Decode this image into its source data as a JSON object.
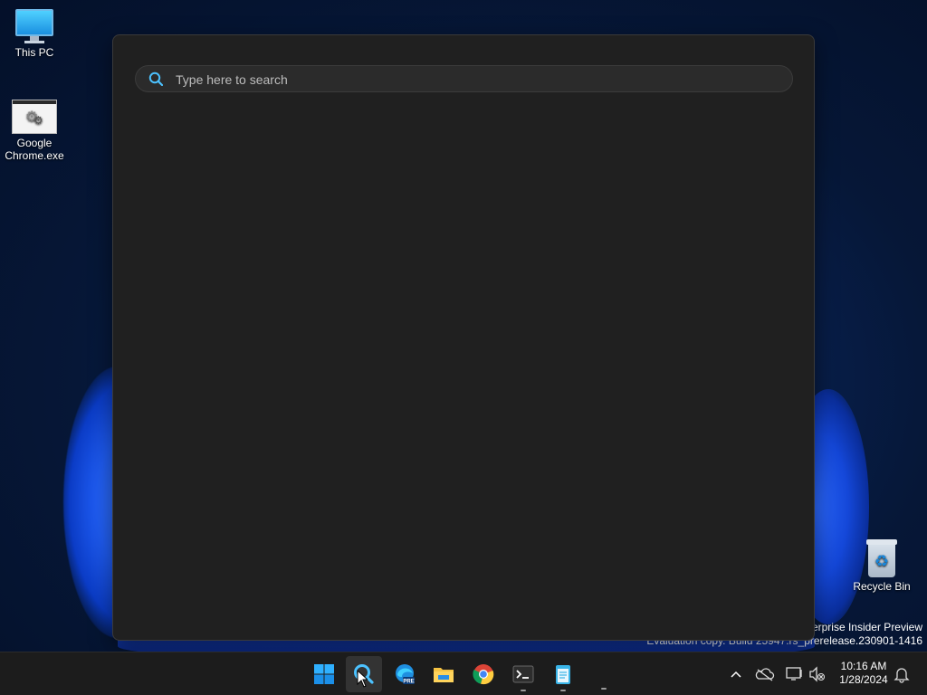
{
  "desktop": {
    "icons": [
      {
        "label": "This PC"
      },
      {
        "label": "Google\nChrome.exe"
      },
      {
        "label": "Recycle Bin"
      }
    ],
    "watermark": {
      "line1": "terprise Insider Preview",
      "line2": "Evaluation copy. Build 25947.rs_prerelease.230901-1416"
    }
  },
  "search": {
    "placeholder": "Type here to search",
    "value": ""
  },
  "taskbar": {
    "apps": [
      {
        "icon": "windows-start-icon"
      },
      {
        "icon": "search-icon",
        "active": true
      },
      {
        "icon": "edge-beta-icon",
        "badge": "PRE"
      },
      {
        "icon": "file-explorer-icon"
      },
      {
        "icon": "chrome-icon"
      },
      {
        "icon": "terminal-icon"
      },
      {
        "icon": "notepad-icon"
      }
    ],
    "tray": {
      "time": "10:16 AM",
      "date": "1/28/2024"
    }
  },
  "colors": {
    "panel_bg": "#202020",
    "taskbar_bg": "#1c1c1c",
    "accent": "#0078d4"
  }
}
